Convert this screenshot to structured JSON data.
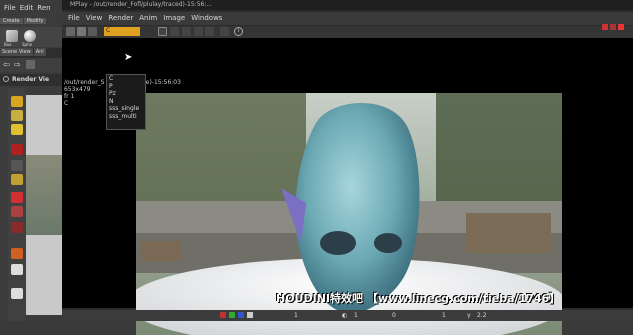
{
  "houdini": {
    "menus": [
      "File",
      "Edit",
      "Ren"
    ],
    "shelf_tabs": [
      "Create",
      "Modify"
    ],
    "shelf_labels": [
      "Box",
      "Sphe"
    ],
    "scene_tabs": [
      "Scene View",
      "Ani"
    ],
    "render_view_tab": "Render Vie"
  },
  "mplay": {
    "title": "MPlay - /out/render_Fofl/plulay/traced)-15:56:...",
    "menus": [
      "File",
      "View",
      "Render",
      "Anim",
      "Image",
      "Windows"
    ],
    "plane_selected": "C",
    "plane_options": [
      "C",
      "P",
      "Pz",
      "N",
      "sss_single",
      "sss_multi"
    ],
    "info_lines": [
      "/out/render_S",
      "653x479",
      "fr 1",
      "C"
    ],
    "info_suffix": "ce)-15:56:03",
    "watermark": "HOUDINI特效吧 【www.linecg.com/tieba/1746】",
    "bottom": {
      "field1": "1",
      "field2": "1",
      "field3": "0",
      "field4": "1",
      "gamma": "2.2"
    }
  }
}
